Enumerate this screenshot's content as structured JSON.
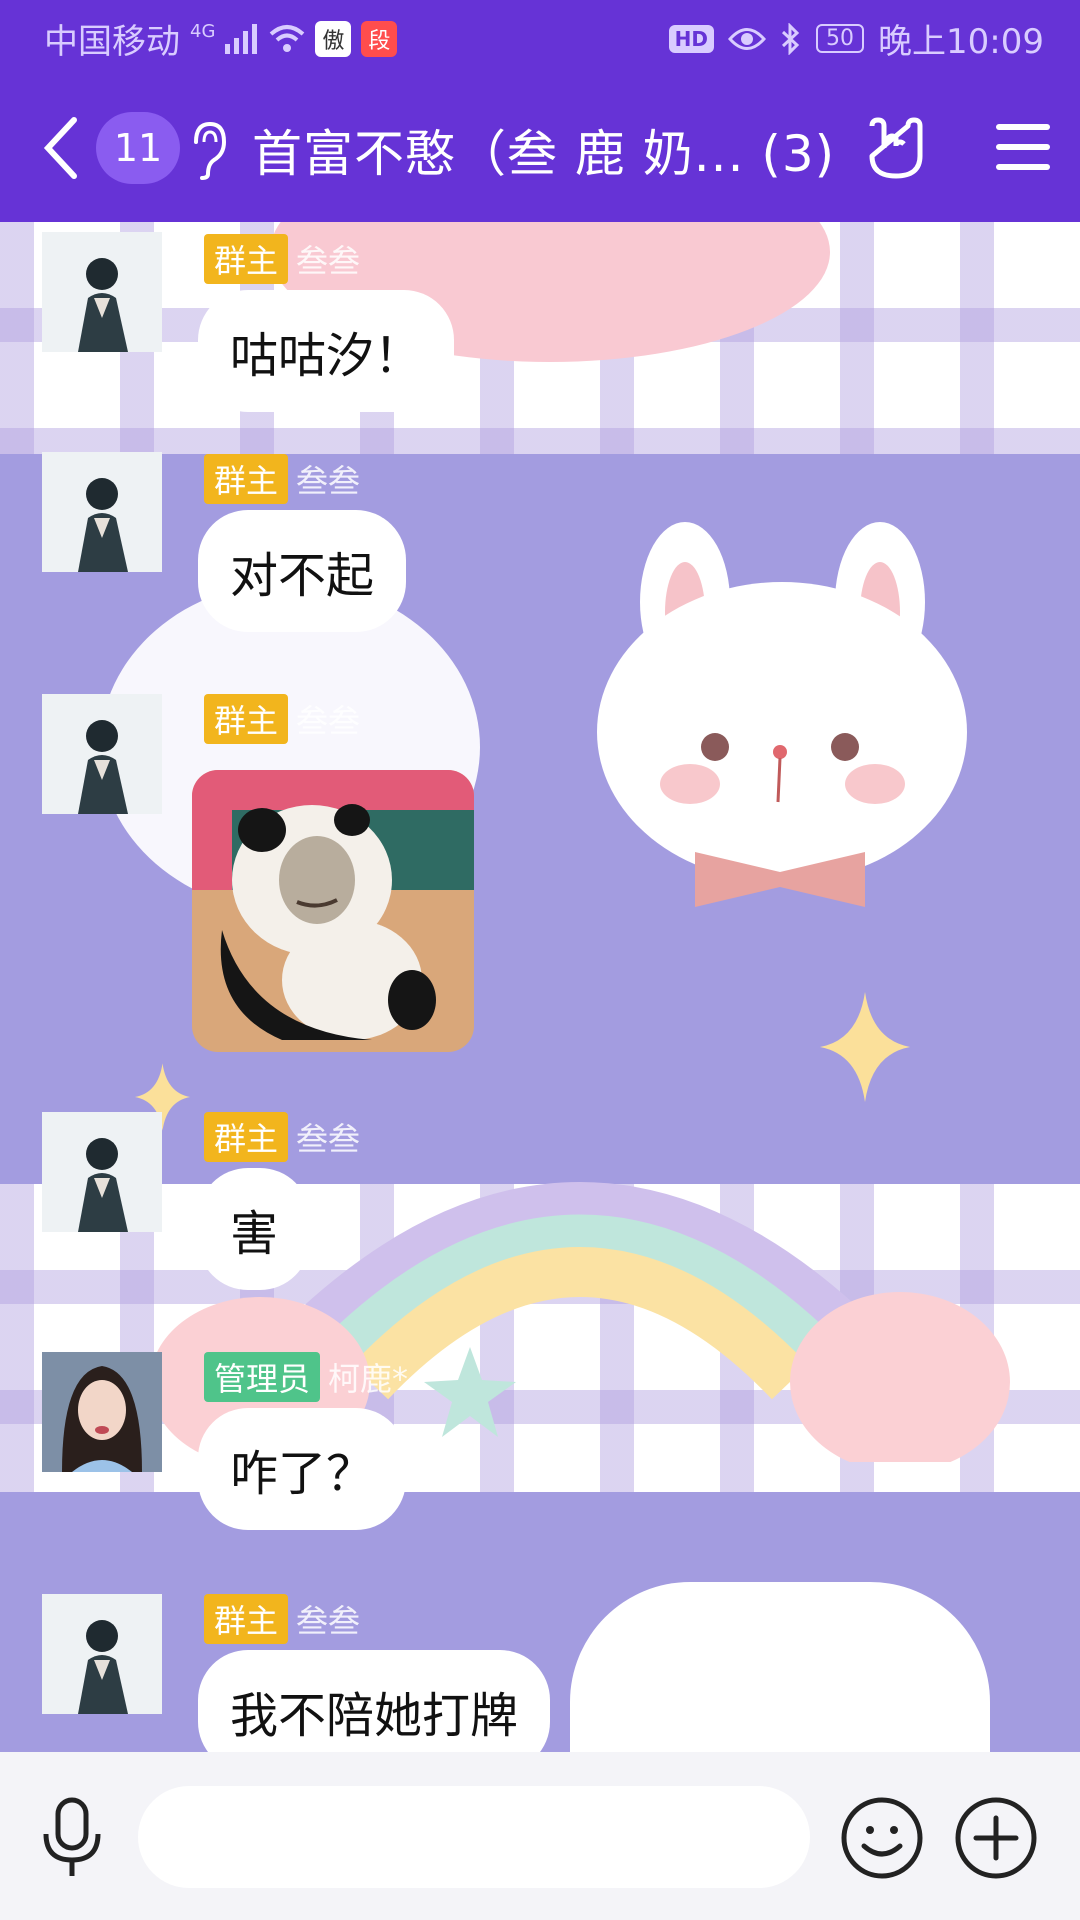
{
  "status_bar": {
    "carrier": "中国移动",
    "network": "4G",
    "app_icon_1": "傲",
    "app_icon_2": "段",
    "hd": "HD",
    "battery": "50",
    "time": "晚上10:09"
  },
  "header": {
    "unread_count": "11",
    "title": "首富不憨（叁 鹿 奶... (3)",
    "icons": [
      "back-chevron-icon",
      "ear-icon",
      "hand-gesture-icon",
      "menu-icon"
    ]
  },
  "colors": {
    "brand": "#6633D6",
    "owner_badge": "#F2B51D",
    "admin_badge": "#4FC48A",
    "background_purple": "#A39CE0"
  },
  "messages": [
    {
      "role": "群主",
      "sender": "叁叁",
      "text": "咕咕汐！",
      "type": "text"
    },
    {
      "role": "群主",
      "sender": "叁叁",
      "text": "对不起",
      "type": "text"
    },
    {
      "role": "群主",
      "sender": "叁叁",
      "text": "",
      "type": "sticker",
      "sticker": "panda-meme-sticker"
    },
    {
      "role": "群主",
      "sender": "叁叁",
      "text": "害",
      "type": "text"
    },
    {
      "role": "管理员",
      "sender": "柯鹿*",
      "text": "咋了？",
      "type": "text"
    },
    {
      "role": "群主",
      "sender": "叁叁",
      "text": "我不陪她打牌",
      "type": "text"
    }
  ],
  "input": {
    "placeholder": "",
    "value": ""
  }
}
